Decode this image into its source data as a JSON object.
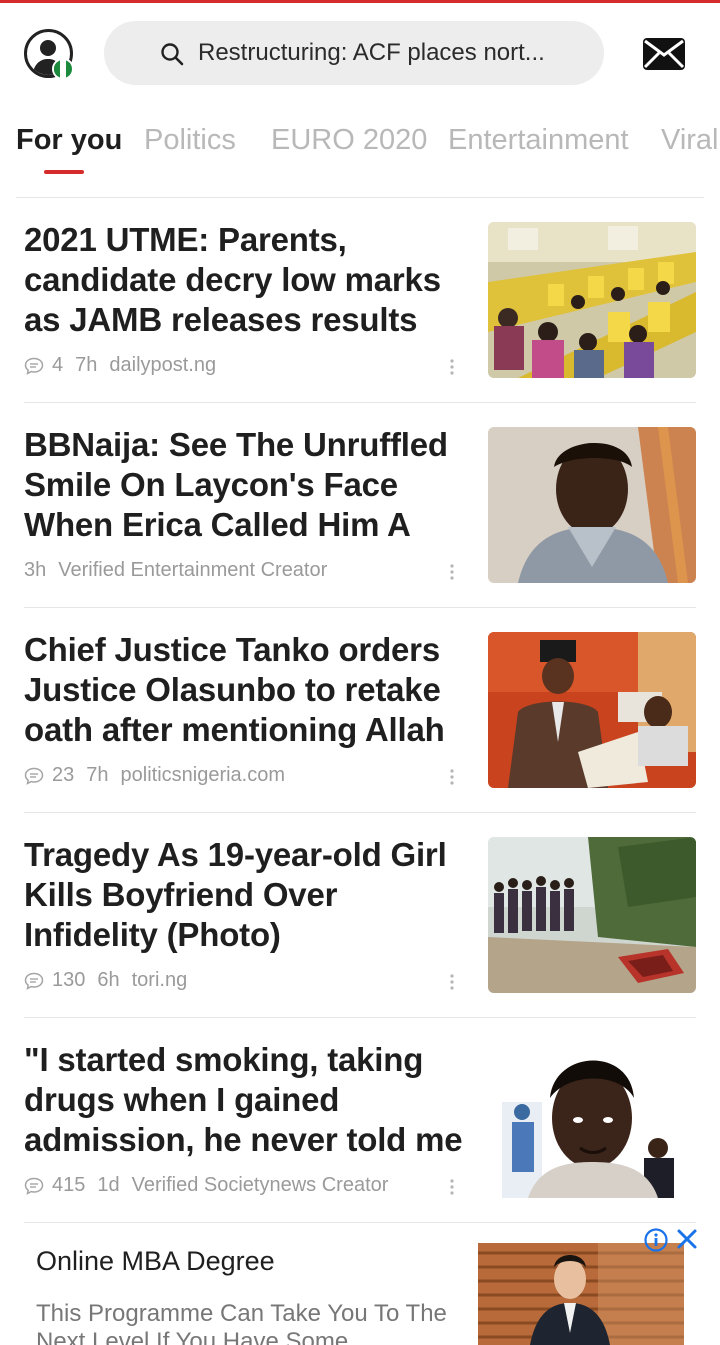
{
  "header": {
    "search_text": "Restructuring: ACF places nort...",
    "flag_colors": [
      "#1c8a3c",
      "#ffffff",
      "#1c8a3c"
    ]
  },
  "tabs": [
    {
      "label": "For you",
      "active": true
    },
    {
      "label": "Politics",
      "active": false
    },
    {
      "label": "EURO 2020",
      "active": false
    },
    {
      "label": "Entertainment",
      "active": false
    },
    {
      "label": "Viral",
      "active": false
    }
  ],
  "articles": [
    {
      "headline": "2021 UTME: Parents, candidate decry low marks as JAMB releases results",
      "comments": "4",
      "time": "7h",
      "source": "dailypost.ng",
      "thumb": "exam-hall-photo"
    },
    {
      "headline": "BBNaija: See The Unruffled Smile On Laycon's Face When Erica Called Him A",
      "comments": "",
      "time": "3h",
      "source": "Verified Entertainment Creator",
      "thumb": "portrait-photo"
    },
    {
      "headline": "Chief Justice Tanko orders Justice Olasunbo to retake oath after mentioning Allah",
      "comments": "23",
      "time": "7h",
      "source": "politicsnigeria.com",
      "thumb": "oath-ceremony-photo"
    },
    {
      "headline": "Tragedy As 19-year-old Girl Kills Boyfriend Over Infidelity (Photo)",
      "comments": "130",
      "time": "6h",
      "source": "tori.ng",
      "thumb": "crowd-scene-photo"
    },
    {
      "headline": "\"I started smoking, taking drugs when I gained admission, he never told me",
      "comments": "415",
      "time": "1d",
      "source": "Verified Societynews Creator",
      "thumb": "woman-portrait-photo"
    }
  ],
  "ad": {
    "title": "Online MBA Degree",
    "body": "This Programme Can Take You To The Next Level If You Have Some",
    "info_icon": "info-icon",
    "close_icon": "close-icon"
  },
  "colors": {
    "accent": "#d62b2b",
    "tab_inactive": "#b8b8b8",
    "meta": "#9a9a9a",
    "search_bg": "#ededed",
    "ad_icon": "#1a73e8"
  }
}
